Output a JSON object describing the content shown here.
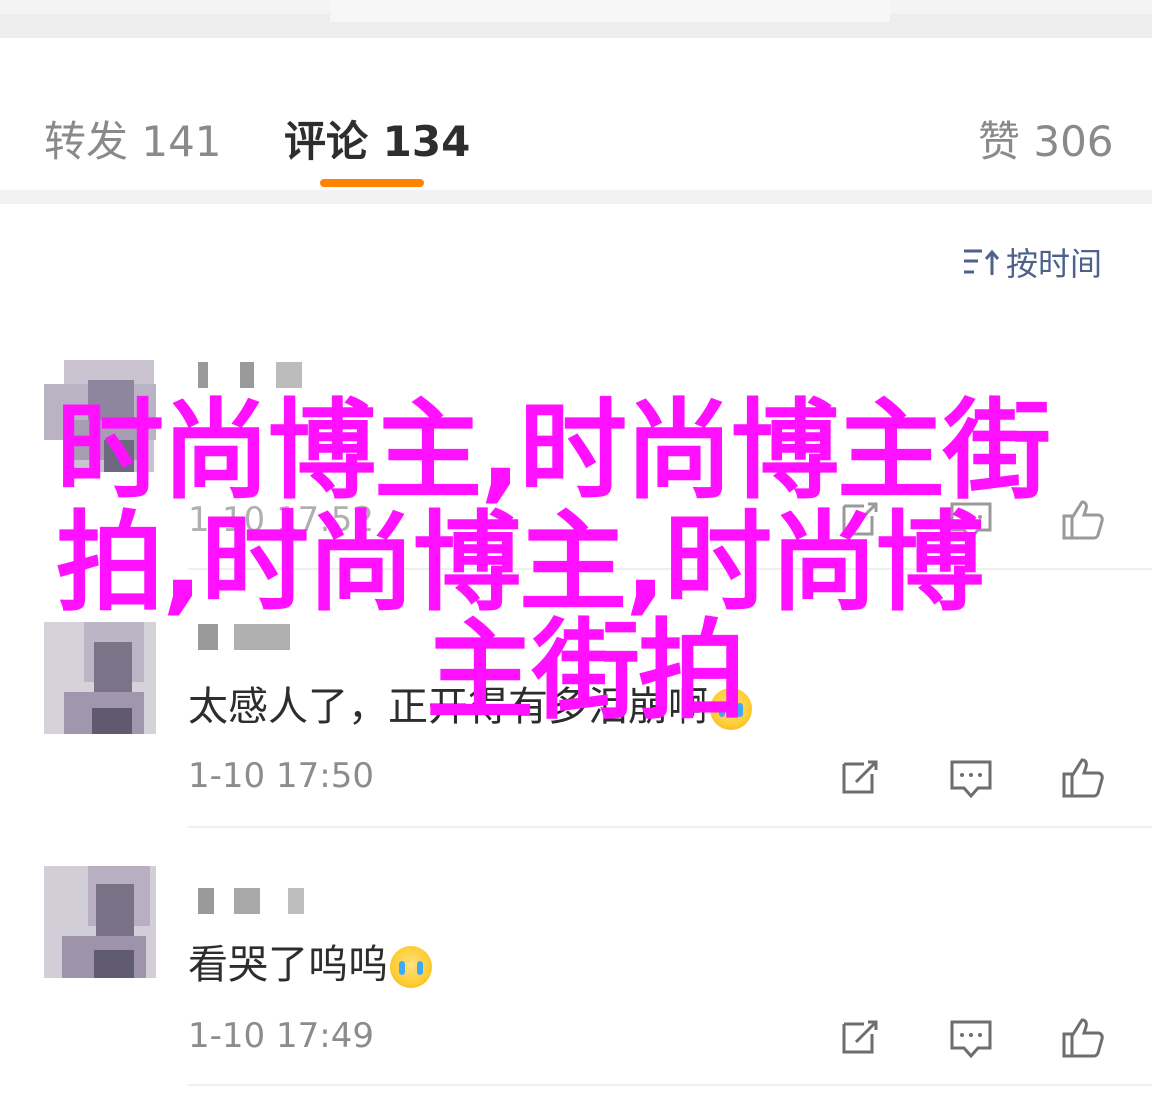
{
  "tabs": {
    "repost": "转发 141",
    "comments": "评论 134",
    "likes": "赞 306"
  },
  "sort": {
    "label": "按时间",
    "icon": "sort-icon"
  },
  "comments": [
    {
      "text": "",
      "time": "1-10 17:52",
      "icons": [
        "repost-icon",
        "reply-icon",
        "like-icon"
      ]
    },
    {
      "text": "太感人了，正开得有多泪崩啊",
      "time": "1-10 17:50",
      "emoji": "crying-emoji",
      "icons": [
        "repost-icon",
        "reply-icon",
        "like-icon"
      ]
    },
    {
      "text": "看哭了呜呜",
      "time": "1-10 17:49",
      "emoji": "crying-emoji",
      "icons": [
        "repost-icon",
        "reply-icon",
        "like-icon"
      ]
    }
  ],
  "overlay": {
    "line1": "时尚博主,时尚博主街",
    "line2": "拍,时尚博主,时尚博",
    "line3": "主街拍"
  },
  "colors": {
    "accent": "#ff8200",
    "link": "#4d6189",
    "overlay": "#ff10ff"
  }
}
